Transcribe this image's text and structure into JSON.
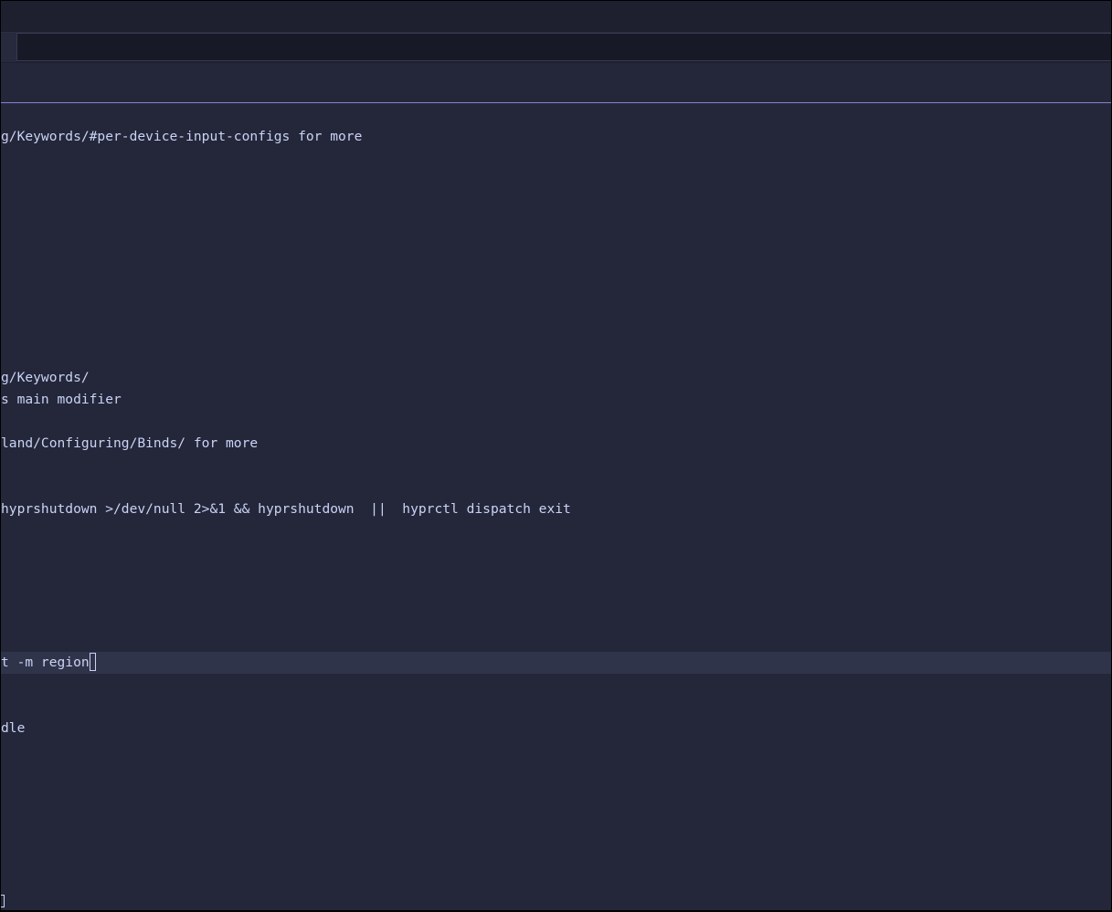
{
  "window": {
    "background": "#24273a",
    "accent_line": "#8a7fd0"
  },
  "editor": {
    "lines": [
      "g/Keywords/#per-device-input-configs for more",
      "g/Keywords/",
      "s main modifier",
      "land/Configuring/Binds/ for more",
      "hyprshutdown >/dev/null 2>&1 && hyprshutdown  ||  hyprctl dispatch exit",
      "t -m region",
      "dle"
    ]
  }
}
